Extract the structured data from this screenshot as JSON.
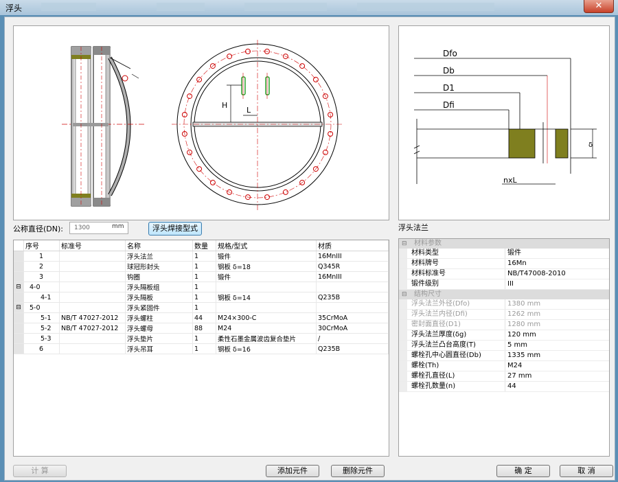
{
  "window": {
    "title": "浮头",
    "close_glyph": "✕"
  },
  "drawing": {
    "dim_h": "H",
    "dim_l": "L"
  },
  "detail": {
    "labels": {
      "dfo": "Dfo",
      "db": "Db",
      "d1": "D1",
      "dfi": "Dfi",
      "nxl": "nxL",
      "thk": "δ"
    }
  },
  "dn": {
    "label": "公称直径(DN):",
    "value": "1300",
    "unit": "mm"
  },
  "weld_button": "浮头焊接型式",
  "part_caption": "浮头法兰",
  "table": {
    "headers": [
      "序号",
      "标准号",
      "名称",
      "数量",
      "规格/型式",
      "材质"
    ],
    "rows": [
      {
        "toggle": "",
        "seq": "1",
        "std": "",
        "name": "浮头法兰",
        "qty": "1",
        "spec": "锻件",
        "mat": "16MnIII"
      },
      {
        "toggle": "",
        "seq": "2",
        "std": "",
        "name": "球冠形封头",
        "qty": "1",
        "spec": "钢板 δ=18",
        "mat": "Q345R"
      },
      {
        "toggle": "",
        "seq": "3",
        "std": "",
        "name": "钩圈",
        "qty": "1",
        "spec": "锻件",
        "mat": "16MnIII"
      },
      {
        "toggle": "⊟",
        "seq": "4-0",
        "std": "",
        "name": "浮头隔板组",
        "qty": "1",
        "spec": "",
        "mat": ""
      },
      {
        "toggle": "",
        "seq": "4-1",
        "std": "",
        "name": "浮头隔板",
        "qty": "1",
        "spec": "钢板 δ=14",
        "mat": "Q235B"
      },
      {
        "toggle": "⊟",
        "seq": "5-0",
        "std": "",
        "name": "浮头紧固件",
        "qty": "1",
        "spec": "",
        "mat": ""
      },
      {
        "toggle": "",
        "seq": "5-1",
        "std": "NB/T 47027-2012",
        "name": "浮头螺柱",
        "qty": "44",
        "spec": "M24×300-C",
        "mat": "35CrMoA"
      },
      {
        "toggle": "",
        "seq": "5-2",
        "std": "NB/T 47027-2012",
        "name": "浮头螺母",
        "qty": "88",
        "spec": "M24",
        "mat": "30CrMoA"
      },
      {
        "toggle": "",
        "seq": "5-3",
        "std": "",
        "name": "浮头垫片",
        "qty": "1",
        "spec": "柔性石墨金属波齿复合垫片",
        "mat": "/"
      },
      {
        "toggle": "",
        "seq": "6",
        "std": "",
        "name": "浮头吊耳",
        "qty": "1",
        "spec": "钢板 δ=16",
        "mat": "Q235B"
      }
    ]
  },
  "properties": {
    "groups": [
      {
        "title": "材料参数",
        "toggle": "⊟",
        "rows": [
          {
            "k": "材料类型",
            "v": "锻件",
            "dim": false
          },
          {
            "k": "材料牌号",
            "v": "16Mn",
            "dim": false
          },
          {
            "k": "材料标准号",
            "v": "NB/T47008-2010",
            "dim": false
          },
          {
            "k": "锻件级别",
            "v": "III",
            "dim": false
          }
        ]
      },
      {
        "title": "结构尺寸",
        "toggle": "⊟",
        "rows": [
          {
            "k": "浮头法兰外径(Dfo)",
            "v": "1380  mm",
            "dim": true
          },
          {
            "k": "浮头法兰内径(Dfi)",
            "v": "1262  mm",
            "dim": true
          },
          {
            "k": "密封面直径(D1)",
            "v": "1280  mm",
            "dim": true
          },
          {
            "k": "浮头法兰厚度(δg)",
            "v": "120  mm",
            "dim": false
          },
          {
            "k": "浮头法兰凸台高度(T)",
            "v": "5  mm",
            "dim": false
          },
          {
            "k": "螺栓孔中心圆直径(Db)",
            "v": "1335  mm",
            "dim": false
          },
          {
            "k": "螺栓(Th)",
            "v": "M24",
            "dim": false
          },
          {
            "k": "螺栓孔直径(L)",
            "v": "27  mm",
            "dim": false
          },
          {
            "k": "螺栓孔数量(n)",
            "v": "44",
            "dim": false
          }
        ]
      }
    ]
  },
  "buttons": {
    "calc": "计  算",
    "add": "添加元件",
    "delete": "删除元件",
    "ok": "确  定",
    "cancel": "取  消"
  },
  "colors": {
    "steel": "#b8b8b8",
    "flange": "#7f7f1f",
    "centerline": "#d00000",
    "bolt": "#cc0000",
    "stud": "#2aa02a"
  }
}
